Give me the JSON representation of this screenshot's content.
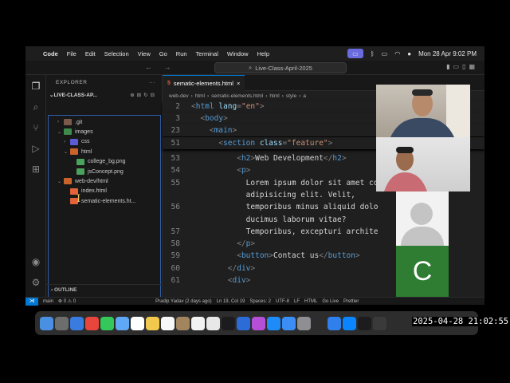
{
  "menubar": {
    "items": [
      "Code",
      "File",
      "Edit",
      "Selection",
      "View",
      "Go",
      "Run",
      "Terminal",
      "Window",
      "Help"
    ],
    "datetime": "Mon 28 Apr  9:02 PM"
  },
  "window": {
    "search": "Live-Class-April-2025"
  },
  "sidebar": {
    "title": "EXPLORER",
    "project": "LIVE-CLASS-AP...",
    "tree": [
      {
        "label": ".git",
        "icon": "git-folder-icon",
        "depth": 1,
        "chev": "›"
      },
      {
        "label": "images",
        "icon": "images-folder-icon",
        "depth": 1,
        "chev": "⌄"
      },
      {
        "label": "css",
        "icon": "css-folder-icon",
        "depth": 2,
        "chev": "›"
      },
      {
        "label": "html",
        "icon": "html-folder-icon",
        "depth": 2,
        "chev": "⌄"
      },
      {
        "label": "college_bg.png",
        "icon": "image-file-icon",
        "depth": 3,
        "chev": ""
      },
      {
        "label": "jsConcept.png",
        "icon": "image-file-icon",
        "depth": 3,
        "chev": ""
      },
      {
        "label": "web-dev/html",
        "icon": "html-folder-icon",
        "depth": 1,
        "chev": "⌄"
      },
      {
        "label": "index.html",
        "icon": "html-file-icon",
        "depth": 2,
        "chev": ""
      },
      {
        "label": "sematic-elements.ht...",
        "icon": "html-file-icon",
        "depth": 2,
        "chev": ""
      }
    ],
    "outline": "OUTLINE"
  },
  "editor": {
    "tab": "sematic-elements.html",
    "breadcrumb": [
      "web-dev",
      "html",
      "sematic-elements.html",
      "html",
      "style",
      "a"
    ],
    "lines": [
      {
        "n": "2",
        "sticky": true,
        "parts": [
          [
            "p",
            "<"
          ],
          [
            "t",
            "html"
          ],
          [
            "a",
            " lang"
          ],
          [
            "p",
            "="
          ],
          [
            "s",
            "\"en\""
          ],
          [
            "p",
            ">"
          ]
        ]
      },
      {
        "n": "3",
        "sticky": true,
        "parts": [
          [
            "txt",
            "  "
          ],
          [
            "p",
            "<"
          ],
          [
            "t",
            "body"
          ],
          [
            "p",
            ">"
          ]
        ]
      },
      {
        "n": "23",
        "sticky": true,
        "parts": [
          [
            "txt",
            "    "
          ],
          [
            "p",
            "<"
          ],
          [
            "t",
            "main"
          ],
          [
            "p",
            ">"
          ]
        ]
      },
      {
        "n": "51",
        "sticky": true,
        "parts": [
          [
            "txt",
            "      "
          ],
          [
            "p",
            "<"
          ],
          [
            "t",
            "section"
          ],
          [
            "a",
            " class"
          ],
          [
            "p",
            "="
          ],
          [
            "s",
            "\"feature\""
          ],
          [
            "p",
            ">"
          ]
        ]
      },
      {
        "n": "53",
        "sticky": false,
        "parts": [
          [
            "txt",
            "          "
          ],
          [
            "p",
            "<"
          ],
          [
            "t",
            "h2"
          ],
          [
            "p",
            ">"
          ],
          [
            "txt",
            "Web Development"
          ],
          [
            "p",
            "</"
          ],
          [
            "t",
            "h2"
          ],
          [
            "p",
            ">"
          ]
        ]
      },
      {
        "n": "54",
        "sticky": false,
        "parts": [
          [
            "txt",
            "          "
          ],
          [
            "p",
            "<"
          ],
          [
            "t",
            "p"
          ],
          [
            "p",
            ">"
          ]
        ]
      },
      {
        "n": "55",
        "sticky": false,
        "parts": [
          [
            "txt",
            "            Lorem ipsum dolor sit amet co"
          ]
        ]
      },
      {
        "n": "",
        "sticky": false,
        "parts": [
          [
            "txt",
            "            adipisicing elit. Velit,"
          ]
        ]
      },
      {
        "n": "56",
        "sticky": false,
        "parts": [
          [
            "txt",
            "            temporibus minus aliquid dolo"
          ]
        ]
      },
      {
        "n": "",
        "sticky": false,
        "parts": [
          [
            "txt",
            "            ducimus laborum vitae?"
          ]
        ]
      },
      {
        "n": "57",
        "sticky": false,
        "parts": [
          [
            "txt",
            "            Temporibus, excepturi archite"
          ]
        ]
      },
      {
        "n": "58",
        "sticky": false,
        "parts": [
          [
            "txt",
            "          "
          ],
          [
            "p",
            "</"
          ],
          [
            "t",
            "p"
          ],
          [
            "p",
            ">"
          ]
        ]
      },
      {
        "n": "59",
        "sticky": false,
        "parts": [
          [
            "txt",
            "          "
          ],
          [
            "p",
            "<"
          ],
          [
            "t",
            "button"
          ],
          [
            "p",
            ">"
          ],
          [
            "txt",
            "Contact us"
          ],
          [
            "p",
            "</"
          ],
          [
            "t",
            "button"
          ],
          [
            "p",
            ">"
          ]
        ]
      },
      {
        "n": "60",
        "sticky": false,
        "parts": [
          [
            "txt",
            "        "
          ],
          [
            "p",
            "</"
          ],
          [
            "t",
            "div"
          ],
          [
            "p",
            ">"
          ]
        ]
      },
      {
        "n": "61",
        "sticky": false,
        "parts": [
          [
            "txt",
            "        "
          ],
          [
            "p",
            "<"
          ],
          [
            "t",
            "div"
          ],
          [
            "p",
            ">"
          ]
        ]
      }
    ]
  },
  "status": {
    "branch": "main",
    "problems": "⊗ 0  ⚠ 0",
    "blame": "Pradip Yadav (2 days ago)",
    "cursor": "Ln 19, Col 19",
    "spaces": "Spaces: 2",
    "encoding": "UTF-8",
    "eol": "LF",
    "language": "HTML",
    "golive": "Go Live",
    "prettier": "Prettier"
  },
  "participant": {
    "initial": "C"
  },
  "clock": "2025-04-28 21:02:55",
  "dock_colors": [
    "#4a90e2",
    "#6d6d6d",
    "#3a7be0",
    "#e8453c",
    "#34c759",
    "#5fa8f5",
    "#ffffff",
    "#f2c94c",
    "#f7f7f7",
    "#a2845e",
    "#f2f2f2",
    "#e8e8e8",
    "#1c1c1e",
    "#2b6cd8",
    "#b54fd8",
    "#1d8cf8",
    "#3a8ef6",
    "#8e8e93",
    "#2d2d2d",
    "#2f80ed",
    "#0a84ff",
    "#1c1c1e",
    "#3a3a3a"
  ]
}
